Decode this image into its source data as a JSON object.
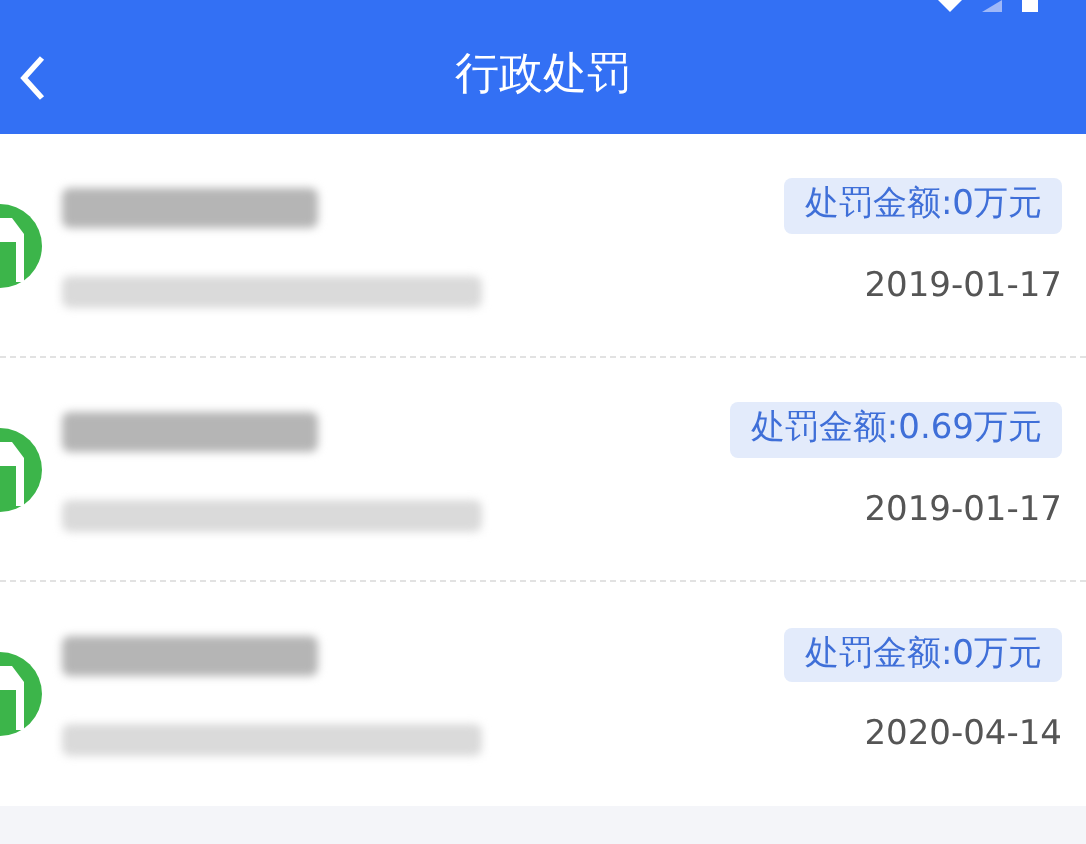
{
  "header": {
    "title": "行政处罚"
  },
  "records": [
    {
      "amount": "处罚金额:0万元",
      "date": "2019-01-17"
    },
    {
      "amount": "处罚金额:0.69万元",
      "date": "2019-01-17"
    },
    {
      "amount": "处罚金额:0万元",
      "date": "2020-04-14"
    }
  ]
}
